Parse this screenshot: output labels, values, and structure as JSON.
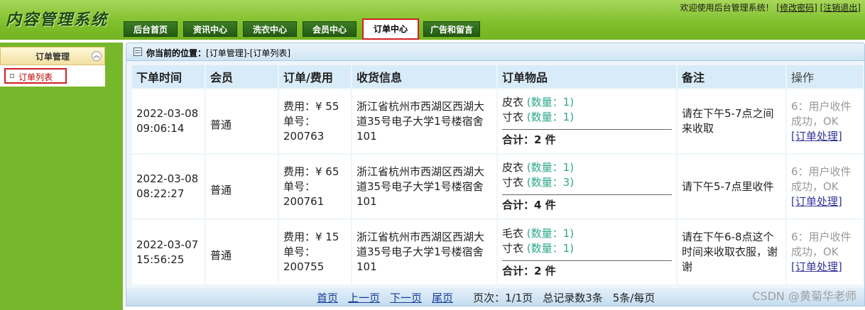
{
  "header": {
    "logo": "内容管理系统",
    "welcome": "欢迎使用后台管理系统！",
    "change_password": "[修改密码]",
    "logout": "[注销退出]",
    "tabs": [
      "后台首页",
      "资讯中心",
      "洗衣中心",
      "会员中心",
      "订单中心",
      "广告和留言"
    ],
    "active_tab": "订单中心"
  },
  "sidebar": {
    "title": "订单管理",
    "collapse_icon": "double-chevron-up-icon",
    "items": [
      "订单列表"
    ]
  },
  "breadcrumb": {
    "prefix": "你当前的位置：",
    "path": "[订单管理]-[订单列表]"
  },
  "table": {
    "headers": [
      "下单时间",
      "会员",
      "订单/费用",
      "收货信息",
      "订单物品",
      "备注",
      "操作"
    ],
    "rows": [
      {
        "date": "2022-03-08",
        "time": "09:06:14",
        "member": "普通",
        "fee": "费用：¥ 55",
        "order_no_label": "单号：",
        "order_no": "200763",
        "address": "浙江省杭州市西湖区西湖大道35号电子大学1号楼宿舍101",
        "items": [
          {
            "name": "皮衣",
            "qty": "(数量：1)"
          },
          {
            "name": "寸衣",
            "qty": "(数量：1)"
          }
        ],
        "total": "合计：2 件",
        "note": "请在下午5-7点之间来收取",
        "status": "6：用户收件成功，OK",
        "action": "[订单处理]"
      },
      {
        "date": "2022-03-08",
        "time": "08:22:27",
        "member": "普通",
        "fee": "费用：¥ 65",
        "order_no_label": "单号：",
        "order_no": "200761",
        "address": "浙江省杭州市西湖区西湖大道35号电子大学1号楼宿舍101",
        "items": [
          {
            "name": "皮衣",
            "qty": "(数量：1)"
          },
          {
            "name": "寸衣",
            "qty": "(数量：3)"
          }
        ],
        "total": "合计：4 件",
        "note": "请下午5-7点里收件",
        "status": "6：用户收件成功，OK",
        "action": "[订单处理]"
      },
      {
        "date": "2022-03-07",
        "time": "15:56:25",
        "member": "普通",
        "fee": "费用：¥ 15",
        "order_no_label": "单号：",
        "order_no": "200755",
        "address": "浙江省杭州市西湖区西湖大道35号电子大学1号楼宿舍101",
        "items": [
          {
            "name": "毛衣",
            "qty": "(数量：1)"
          },
          {
            "name": "寸衣",
            "qty": "(数量：1)"
          }
        ],
        "total": "合计：2 件",
        "note": "请在下午6-8点这个时间来收取衣服，谢谢",
        "status": "6：用户收件成功，OK",
        "action": "[订单处理]"
      }
    ]
  },
  "pager": {
    "first": "首页",
    "prev": "上一页",
    "next": "下一页",
    "last": "尾页",
    "page_info": "页次：1/1页",
    "total_info": "总记录数3条",
    "per_page": "5条/每页"
  },
  "watermark": "CSDN @黄菊华老师",
  "colors": {
    "header_green": "#7fbf2a",
    "active_border": "#d02020",
    "qty_green": "#2ca88a",
    "link_blue": "#333399"
  }
}
